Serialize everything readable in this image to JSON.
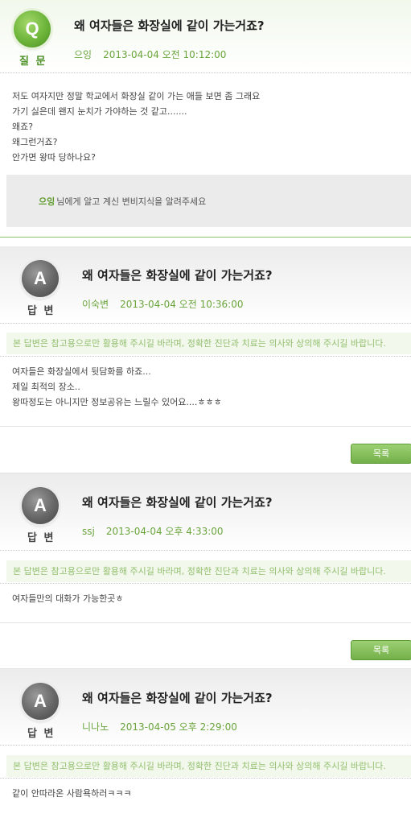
{
  "question": {
    "badge_letter": "Q",
    "badge_caption": "질 문",
    "title": "왜 여자들은 화장실에 같이 가는거죠?",
    "author": "으잉",
    "datetime": "2013-04-04 오전 10:12:00",
    "body_lines": [
      "저도 여자지만 정말 학교에서 화장실 같이 가는 애들 보면 좀 그래요",
      "가기 싫은데 왠지 눈치가 가야하는 것 같고.......",
      "왜죠?",
      "왜그런거죠?",
      "안가면 왕따 당하나요?"
    ],
    "notice_author": "으잉",
    "notice_text": "님에게 알고 계신 변비지식을 알려주세요"
  },
  "disclaimer_text": "본 답변은 참고용으로만 활용해 주시길 바라며, 정확한 진단과 치료는 의사와 상의해 주시길 바랍니다.",
  "list_button_label": "목록",
  "answers": [
    {
      "badge_letter": "A",
      "badge_caption": "답 변",
      "title": "왜 여자들은 화장실에 같이 가는거죠?",
      "author": "이숙변",
      "datetime": "2013-04-04 오전 10:36:00",
      "body_lines": [
        "여자들은 화장실에서 뒷담화를 하죠...",
        "제일 최적의 장소..",
        "왕따정도는 아니지만 정보공유는 느릴수 있어요....ㅎㅎㅎ"
      ]
    },
    {
      "badge_letter": "A",
      "badge_caption": "답 변",
      "title": "왜 여자들은 화장실에 같이 가는거죠?",
      "author": "ssj",
      "datetime": "2013-04-04 오후 4:33:00",
      "body_lines": [
        "여자들만의 대화가 가능한곳ㅎ"
      ]
    },
    {
      "badge_letter": "A",
      "badge_caption": "답 변",
      "title": "왜 여자들은 화장실에 같이 가는거죠?",
      "author": "니나노",
      "datetime": "2013-04-05 오후 2:29:00",
      "body_lines": [
        "같이 안따라온 사람욕하러ㅋㅋㅋ"
      ]
    }
  ]
}
